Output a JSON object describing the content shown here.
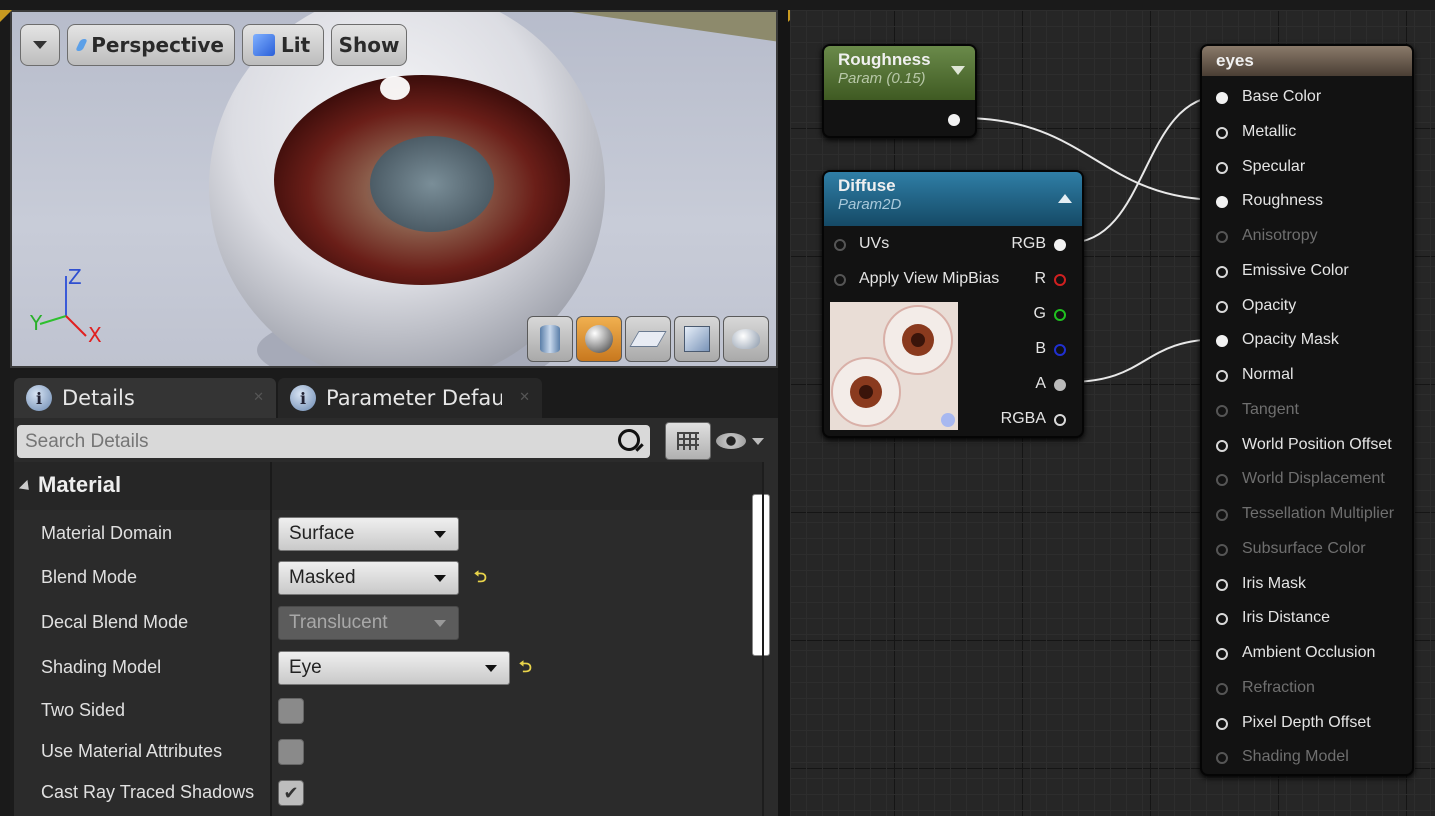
{
  "viewport": {
    "buttons": {
      "menu_label": "",
      "perspective": "Perspective",
      "lit": "Lit",
      "show": "Show"
    },
    "axes": {
      "z": "Z",
      "y": "Y",
      "x": "X"
    },
    "preview_shapes": [
      "cylinder-icon",
      "sphere-icon",
      "plane-icon",
      "cube-icon",
      "teapot-icon"
    ],
    "selected_shape": "sphere-icon"
  },
  "tabs": [
    {
      "label": "Details",
      "active": true
    },
    {
      "label": "Parameter Defaults",
      "active": false
    }
  ],
  "search": {
    "placeholder": "Search Details"
  },
  "material_section": {
    "title": "Material",
    "rows": [
      {
        "label": "Material Domain",
        "type": "dropdown",
        "value": "Surface"
      },
      {
        "label": "Blend Mode",
        "type": "dropdown",
        "value": "Masked",
        "reset": true
      },
      {
        "label": "Decal Blend Mode",
        "type": "dropdown",
        "value": "Translucent",
        "disabled": true
      },
      {
        "label": "Shading Model",
        "type": "dropdown",
        "value": "Eye",
        "reset": true
      },
      {
        "label": "Two Sided",
        "type": "checkbox",
        "checked": false
      },
      {
        "label": "Use Material Attributes",
        "type": "checkbox",
        "checked": false
      },
      {
        "label": "Cast Ray Traced Shadows",
        "type": "checkbox",
        "checked": true
      }
    ]
  },
  "graph": {
    "roughness_node": {
      "title": "Roughness",
      "subtitle": "Param (0.15)",
      "color": "#4a6a2a"
    },
    "diffuse_node": {
      "title": "Diffuse",
      "subtitle": "Param2D",
      "color": "#1e5a7a",
      "inputs": [
        "UVs",
        "Apply View MipBias"
      ],
      "outputs": [
        {
          "label": "RGB",
          "color": "#ffffff"
        },
        {
          "label": "R",
          "color": "#d02020"
        },
        {
          "label": "G",
          "color": "#20c020"
        },
        {
          "label": "B",
          "color": "#2030d0"
        },
        {
          "label": "A",
          "color": "#bbbbbb"
        },
        {
          "label": "RGBA",
          "color": "#ffffff"
        }
      ]
    },
    "result_node": {
      "title": "eyes",
      "pins": [
        {
          "label": "Base Color",
          "state": "connected"
        },
        {
          "label": "Metallic",
          "state": "active"
        },
        {
          "label": "Specular",
          "state": "active"
        },
        {
          "label": "Roughness",
          "state": "connected"
        },
        {
          "label": "Anisotropy",
          "state": "disabled"
        },
        {
          "label": "Emissive Color",
          "state": "active"
        },
        {
          "label": "Opacity",
          "state": "active"
        },
        {
          "label": "Opacity Mask",
          "state": "connected"
        },
        {
          "label": "Normal",
          "state": "active"
        },
        {
          "label": "Tangent",
          "state": "disabled"
        },
        {
          "label": "World Position Offset",
          "state": "active"
        },
        {
          "label": "World Displacement",
          "state": "disabled"
        },
        {
          "label": "Tessellation Multiplier",
          "state": "disabled"
        },
        {
          "label": "Subsurface Color",
          "state": "disabled"
        },
        {
          "label": "Iris Mask",
          "state": "active"
        },
        {
          "label": "Iris Distance",
          "state": "active"
        },
        {
          "label": "Ambient Occlusion",
          "state": "active"
        },
        {
          "label": "Refraction",
          "state": "disabled"
        },
        {
          "label": "Pixel Depth Offset",
          "state": "active"
        },
        {
          "label": "Shading Model",
          "state": "disabled"
        }
      ]
    }
  }
}
